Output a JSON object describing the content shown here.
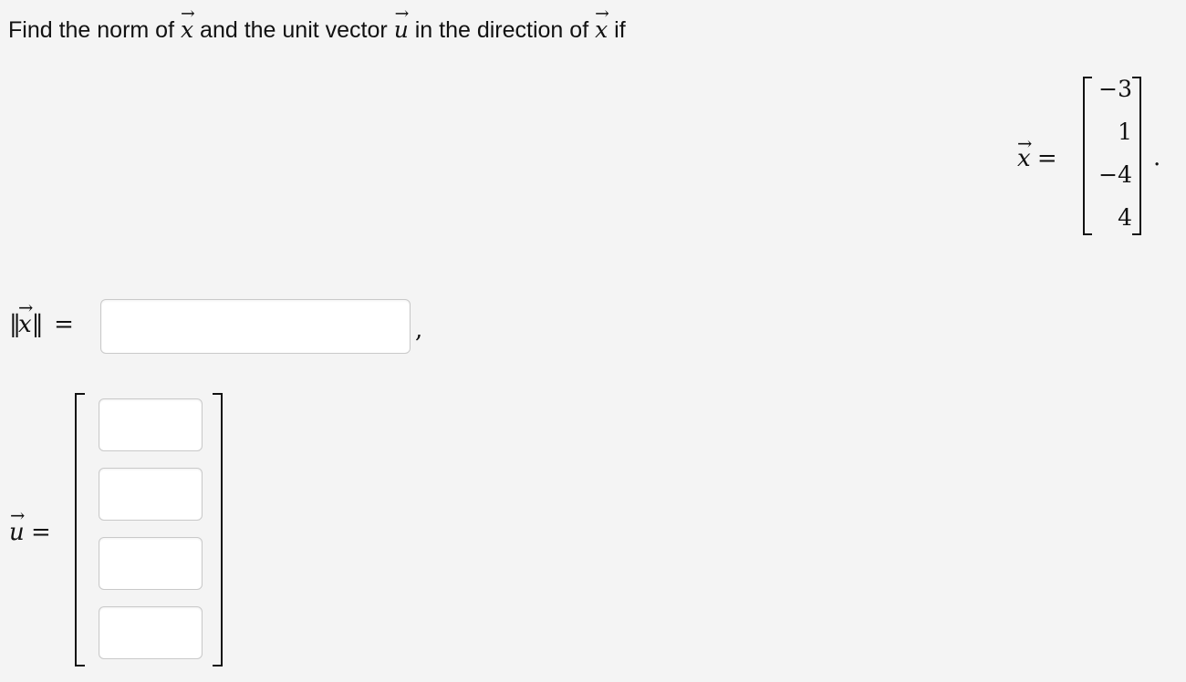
{
  "question": {
    "part1": "Find the norm of ",
    "var_x": "x",
    "part2": " and the unit vector ",
    "var_u": "u",
    "part3": " in the direction of ",
    "var_x2": "x",
    "part4": " if"
  },
  "vector_arrow": "→",
  "given": {
    "var": "x",
    "equals": "=",
    "entries": [
      "−3",
      "1",
      "−4",
      "4"
    ],
    "period": "."
  },
  "norm": {
    "bars_left": "‖",
    "var": "x",
    "bars_right": "‖",
    "equals": "=",
    "value": "",
    "comma": ","
  },
  "unit": {
    "var": "u",
    "equals": "=",
    "entries": [
      "",
      "",
      "",
      ""
    ]
  }
}
